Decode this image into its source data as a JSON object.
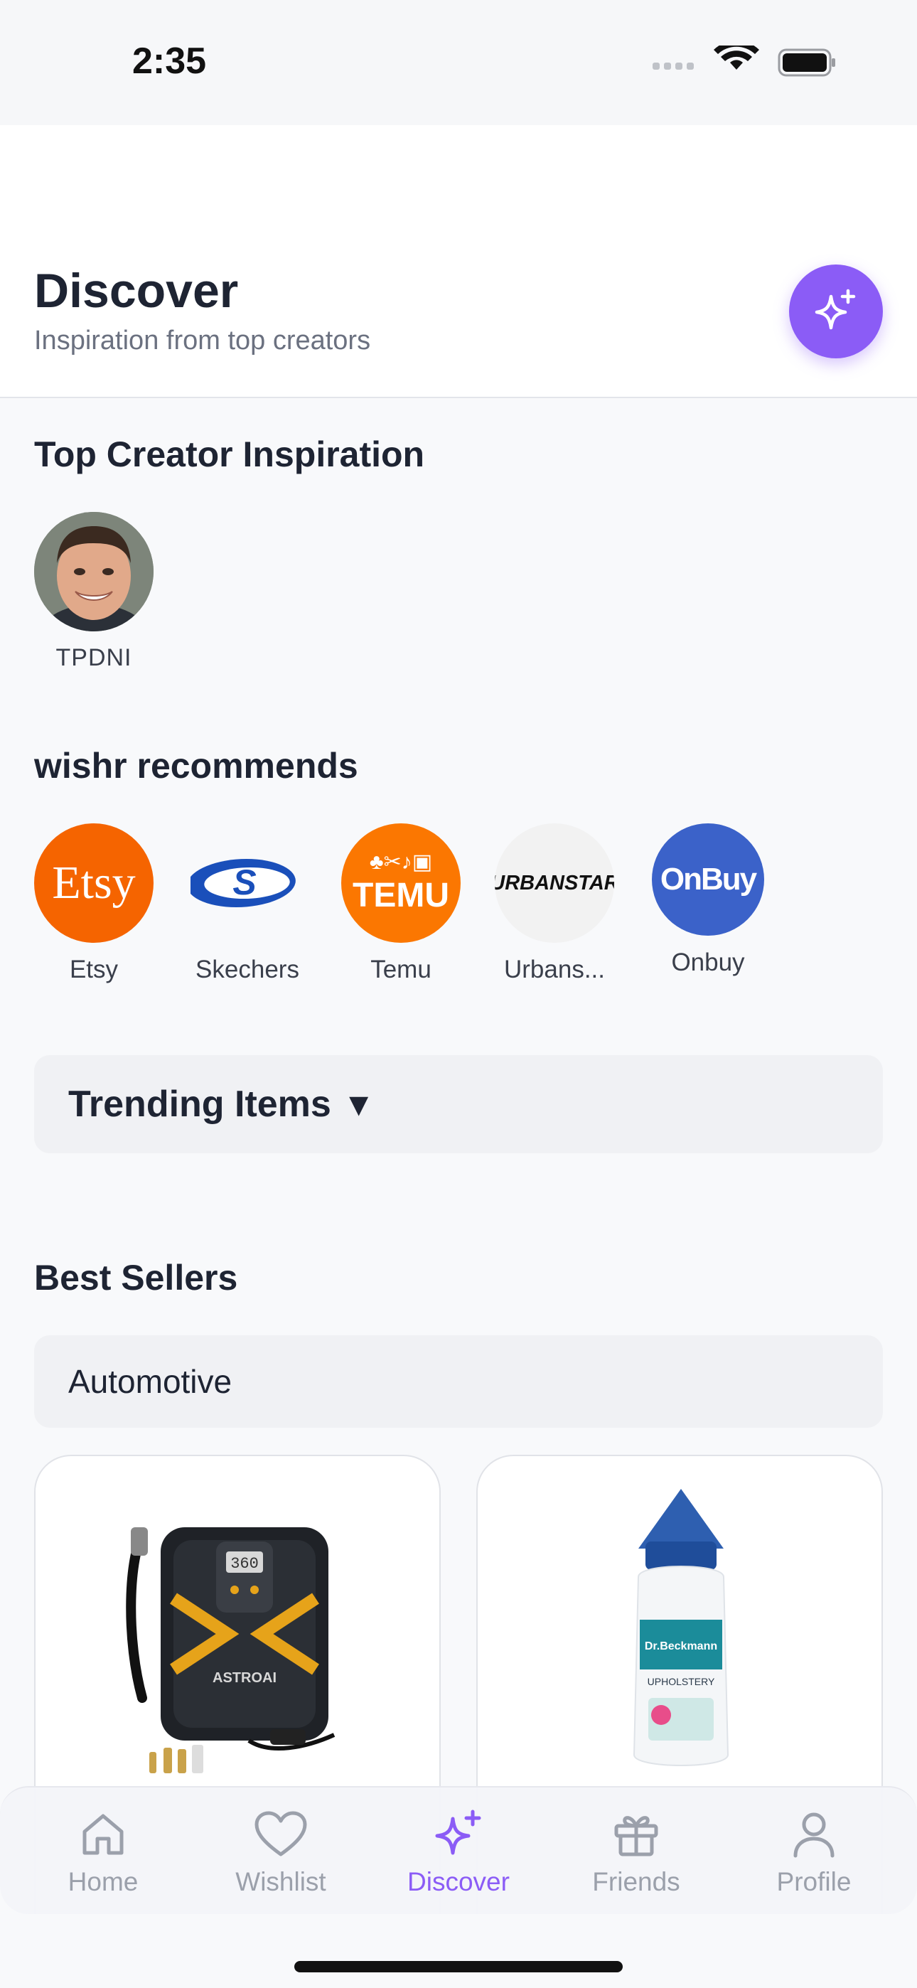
{
  "status_bar": {
    "time": "2:35"
  },
  "header": {
    "title": "Discover",
    "subtitle": "Inspiration from top creators",
    "ai_button_icon": "sparkle-icon"
  },
  "creators_section": {
    "title": "Top Creator Inspiration",
    "creators": [
      {
        "name": "TPDNI"
      }
    ]
  },
  "recommends_section": {
    "title": "wishr recommends",
    "brands": [
      {
        "name": "Etsy",
        "logo_text": "Etsy",
        "color": "#f56400"
      },
      {
        "name": "Skechers",
        "logo_text": "S",
        "color": "#1a4fba"
      },
      {
        "name": "Temu",
        "logo_text": "TEMU",
        "color": "#fb7701"
      },
      {
        "name": "Urbans...",
        "logo_text": "URBANSTAR",
        "color": "#f2f2f2"
      },
      {
        "name": "Onbuy",
        "logo_text": "OnBuy",
        "color": "#3b62c9"
      }
    ]
  },
  "trending": {
    "label": "Trending Items",
    "caret": "▼"
  },
  "best_sellers": {
    "title": "Best Sellers",
    "category": "Automotive",
    "products": [
      {
        "image": "tire-inflator-image",
        "brand_text": "ASTROAI",
        "display": "360"
      },
      {
        "image": "upholstery-cleaner-image",
        "brand_text": "Dr.Beckmann",
        "label_text": "UPHOLSTERY"
      }
    ]
  },
  "tab_bar": {
    "tabs": [
      {
        "label": "Home",
        "icon": "home-icon",
        "active": false
      },
      {
        "label": "Wishlist",
        "icon": "heart-icon",
        "active": false
      },
      {
        "label": "Discover",
        "icon": "sparkle-icon",
        "active": true
      },
      {
        "label": "Friends",
        "icon": "gift-icon",
        "active": false
      },
      {
        "label": "Profile",
        "icon": "person-icon",
        "active": false
      }
    ]
  },
  "colors": {
    "accent": "#8b5cf6",
    "inactive_tab": "#9ba0ab"
  }
}
